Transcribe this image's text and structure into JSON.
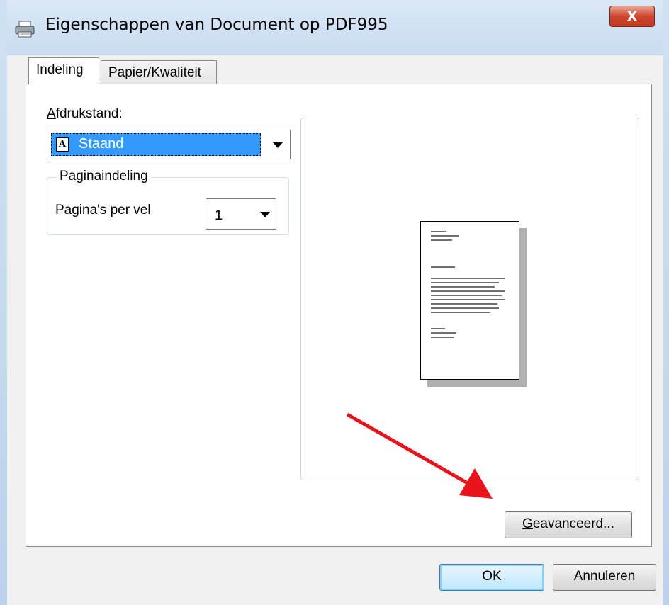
{
  "window": {
    "title": "Eigenschappen van Document op PDF995",
    "close_glyph": "X"
  },
  "tabs": [
    {
      "label": "Indeling",
      "active": true
    },
    {
      "label": "Papier/Kwaliteit",
      "active": false
    }
  ],
  "orientation": {
    "label_accel": "A",
    "label_rest": "fdrukstand:",
    "selected_icon": "A",
    "selected": "Staand"
  },
  "page_layout": {
    "group_title": "Paginaindeling",
    "pages_label_before": "Pagina's pe",
    "pages_label_accel": "r",
    "pages_label_after": " vel",
    "pages_value": "1"
  },
  "buttons": {
    "advanced_accel": "G",
    "advanced_rest": "eavanceerd...",
    "ok": "OK",
    "cancel": "Annuleren"
  },
  "colors": {
    "selection": "#3399ff",
    "annotation_arrow": "#e8141b"
  },
  "icons": {
    "title": "printer-icon",
    "orientation": "portrait-page-icon"
  }
}
